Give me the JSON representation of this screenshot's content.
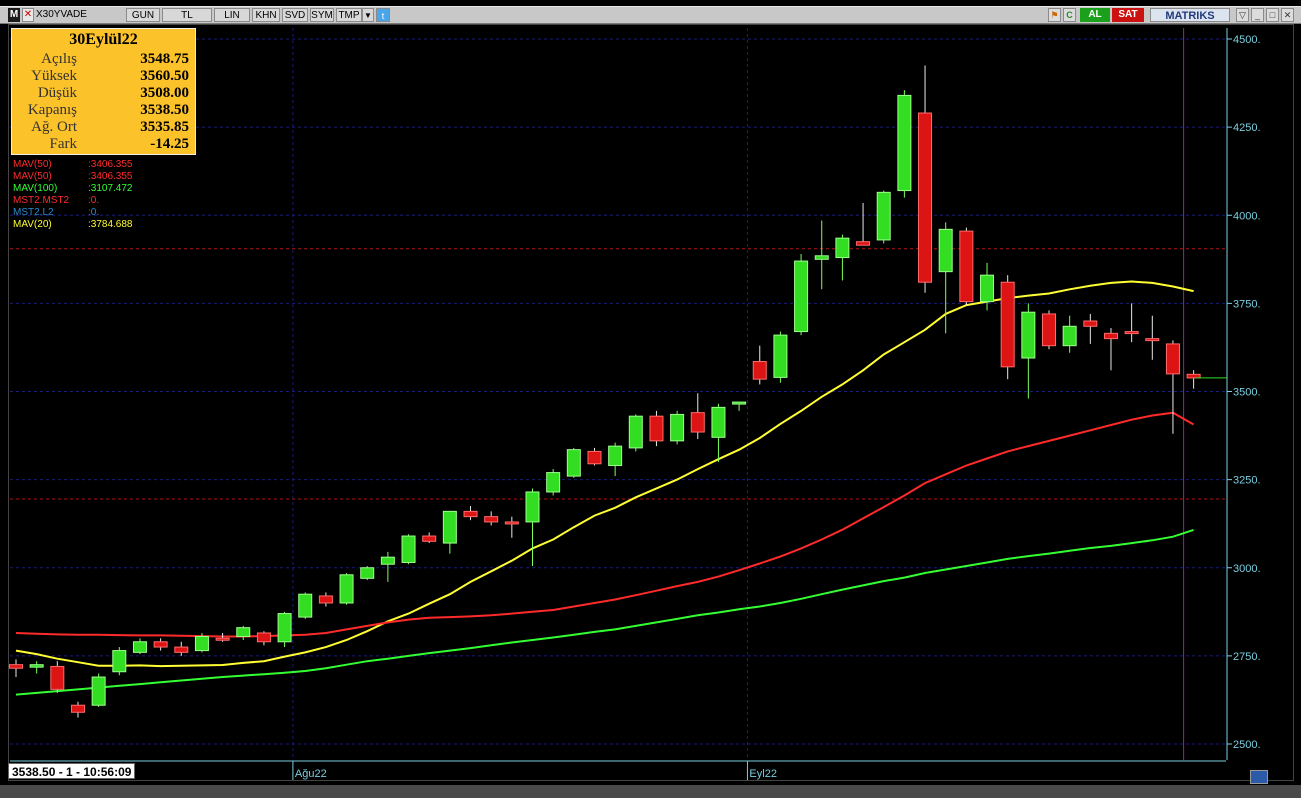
{
  "toolbar": {
    "app_letter": "M",
    "close_icon": "close-x-icon",
    "symbol": "X30YVADE",
    "buttons": [
      "GUN",
      "TL",
      "LIN",
      "KHN",
      "SVD",
      "SYM",
      "TMP"
    ],
    "twitter_icon": "twitter-icon",
    "right_al": "AL",
    "right_sat": "SAT",
    "brand": "MATRIKS"
  },
  "info_box": {
    "date": "30Eylül22",
    "rows": [
      {
        "label": "Açılış",
        "value": "3548.75"
      },
      {
        "label": "Yüksek",
        "value": "3560.50"
      },
      {
        "label": "Düşük",
        "value": "3508.00"
      },
      {
        "label": "Kapanış",
        "value": "3538.50"
      },
      {
        "label": "Ağ. Ort",
        "value": "3535.85"
      },
      {
        "label": "Fark",
        "value": "-14.25"
      }
    ]
  },
  "legend": [
    {
      "label": "MAV(50)",
      "value": ":3406.355",
      "color": "#ff2a2a"
    },
    {
      "label": "MAV(50)",
      "value": ":3406.355",
      "color": "#ff2a2a"
    },
    {
      "label": "MAV(100)",
      "value": ":3107.472",
      "color": "#33ff33"
    },
    {
      "label": "MST2.MST2",
      "value": ":0.",
      "color": "#ff2a2a"
    },
    {
      "label": "MST2.L2",
      "value": ":0.",
      "color": "#2a8acb"
    },
    {
      "label": "MAV(20)",
      "value": ":3784.688",
      "color": "#ffff33"
    }
  ],
  "status_bar": "3538.50 - 1 - 10:56:09",
  "chart_data": {
    "type": "candlestick",
    "y_ticks": [
      "4500.",
      "4250.",
      "4000.",
      "3750.",
      "3500.",
      "3250.",
      "3000.",
      "2750.",
      "2500."
    ],
    "y_tick_values": [
      4500,
      4250,
      4000,
      3750,
      3500,
      3250,
      3000,
      2750,
      2500
    ],
    "ylim": [
      2480,
      4540
    ],
    "x_labels": [
      {
        "label": "Ağu22",
        "index": 14
      },
      {
        "label": "Eyl22",
        "index": 36
      }
    ],
    "reference_lines": [
      3905,
      3195
    ],
    "candles": [
      {
        "o": 2725,
        "h": 2740,
        "l": 2690,
        "c": 2715
      },
      {
        "o": 2718,
        "h": 2735,
        "l": 2700,
        "c": 2725
      },
      {
        "o": 2720,
        "h": 2735,
        "l": 2645,
        "c": 2655
      },
      {
        "o": 2610,
        "h": 2620,
        "l": 2575,
        "c": 2590
      },
      {
        "o": 2610,
        "h": 2700,
        "l": 2605,
        "c": 2690
      },
      {
        "o": 2705,
        "h": 2775,
        "l": 2695,
        "c": 2765
      },
      {
        "o": 2760,
        "h": 2800,
        "l": 2755,
        "c": 2790
      },
      {
        "o": 2790,
        "h": 2800,
        "l": 2765,
        "c": 2775
      },
      {
        "o": 2775,
        "h": 2790,
        "l": 2750,
        "c": 2760
      },
      {
        "o": 2765,
        "h": 2815,
        "l": 2760,
        "c": 2805
      },
      {
        "o": 2800,
        "h": 2815,
        "l": 2790,
        "c": 2795
      },
      {
        "o": 2805,
        "h": 2835,
        "l": 2795,
        "c": 2830
      },
      {
        "o": 2815,
        "h": 2820,
        "l": 2780,
        "c": 2790
      },
      {
        "o": 2790,
        "h": 2875,
        "l": 2775,
        "c": 2870
      },
      {
        "o": 2860,
        "h": 2930,
        "l": 2855,
        "c": 2925
      },
      {
        "o": 2920,
        "h": 2930,
        "l": 2890,
        "c": 2900
      },
      {
        "o": 2900,
        "h": 2985,
        "l": 2895,
        "c": 2980
      },
      {
        "o": 2970,
        "h": 3005,
        "l": 2965,
        "c": 3000
      },
      {
        "o": 3010,
        "h": 3045,
        "l": 2960,
        "c": 3030
      },
      {
        "o": 3015,
        "h": 3095,
        "l": 3010,
        "c": 3090
      },
      {
        "o": 3090,
        "h": 3100,
        "l": 3070,
        "c": 3075
      },
      {
        "o": 3070,
        "h": 3160,
        "l": 3040,
        "c": 3160
      },
      {
        "o": 3160,
        "h": 3175,
        "l": 3135,
        "c": 3145
      },
      {
        "o": 3145,
        "h": 3160,
        "l": 3120,
        "c": 3130
      },
      {
        "o": 3130,
        "h": 3145,
        "l": 3085,
        "c": 3125
      },
      {
        "o": 3130,
        "h": 3225,
        "l": 3005,
        "c": 3215
      },
      {
        "o": 3215,
        "h": 3280,
        "l": 3205,
        "c": 3270
      },
      {
        "o": 3260,
        "h": 3340,
        "l": 3255,
        "c": 3335
      },
      {
        "o": 3330,
        "h": 3340,
        "l": 3290,
        "c": 3295
      },
      {
        "o": 3290,
        "h": 3355,
        "l": 3260,
        "c": 3345
      },
      {
        "o": 3340,
        "h": 3435,
        "l": 3330,
        "c": 3430
      },
      {
        "o": 3430,
        "h": 3445,
        "l": 3345,
        "c": 3360
      },
      {
        "o": 3360,
        "h": 3445,
        "l": 3350,
        "c": 3435
      },
      {
        "o": 3440,
        "h": 3495,
        "l": 3365,
        "c": 3385
      },
      {
        "o": 3370,
        "h": 3465,
        "l": 3300,
        "c": 3455
      },
      {
        "o": 3465,
        "h": 3470,
        "l": 3445,
        "c": 3470
      },
      {
        "o": 3585,
        "h": 3630,
        "l": 3520,
        "c": 3535
      },
      {
        "o": 3540,
        "h": 3670,
        "l": 3525,
        "c": 3660
      },
      {
        "o": 3670,
        "h": 3890,
        "l": 3660,
        "c": 3870
      },
      {
        "o": 3875,
        "h": 3985,
        "l": 3790,
        "c": 3885
      },
      {
        "o": 3880,
        "h": 3945,
        "l": 3815,
        "c": 3935
      },
      {
        "o": 3925,
        "h": 4035,
        "l": 3920,
        "c": 3915
      },
      {
        "o": 3930,
        "h": 4070,
        "l": 3920,
        "c": 4065
      },
      {
        "o": 4070,
        "h": 4355,
        "l": 4050,
        "c": 4340
      },
      {
        "o": 4290,
        "h": 4425,
        "l": 3780,
        "c": 3810
      },
      {
        "o": 3840,
        "h": 3980,
        "l": 3665,
        "c": 3960
      },
      {
        "o": 3955,
        "h": 3965,
        "l": 3745,
        "c": 3755
      },
      {
        "o": 3755,
        "h": 3865,
        "l": 3730,
        "c": 3830
      },
      {
        "o": 3810,
        "h": 3830,
        "l": 3535,
        "c": 3570
      },
      {
        "o": 3595,
        "h": 3750,
        "l": 3480,
        "c": 3725
      },
      {
        "o": 3720,
        "h": 3730,
        "l": 3620,
        "c": 3630
      },
      {
        "o": 3630,
        "h": 3715,
        "l": 3610,
        "c": 3685
      },
      {
        "o": 3700,
        "h": 3720,
        "l": 3635,
        "c": 3685
      },
      {
        "o": 3665,
        "h": 3680,
        "l": 3560,
        "c": 3650
      },
      {
        "o": 3670,
        "h": 3750,
        "l": 3640,
        "c": 3665
      },
      {
        "o": 3650,
        "h": 3715,
        "l": 3590,
        "c": 3645
      },
      {
        "o": 3635,
        "h": 3645,
        "l": 3380,
        "c": 3550
      },
      {
        "o": 3548.75,
        "h": 3560.5,
        "l": 3508,
        "c": 3538.5
      }
    ],
    "series": [
      {
        "name": "MAV(20)",
        "color": "#ffff33",
        "values": [
          2765,
          2755,
          2742,
          2732,
          2722,
          2722,
          2723,
          2721,
          2722,
          2723,
          2724,
          2730,
          2735,
          2748,
          2760,
          2775,
          2795,
          2820,
          2848,
          2870,
          2898,
          2925,
          2960,
          2990,
          3020,
          3055,
          3080,
          3115,
          3148,
          3170,
          3200,
          3225,
          3250,
          3280,
          3308,
          3335,
          3368,
          3408,
          3445,
          3485,
          3520,
          3560,
          3605,
          3640,
          3675,
          3720,
          3745,
          3755,
          3765,
          3772,
          3778,
          3790,
          3800,
          3808,
          3812,
          3808,
          3798,
          3784.688
        ]
      },
      {
        "name": "MAV(50)",
        "color": "#ff2a2a",
        "values": [
          2815,
          2813,
          2811,
          2810,
          2810,
          2809,
          2808,
          2808,
          2807,
          2806,
          2805,
          2805,
          2806,
          2808,
          2810,
          2815,
          2825,
          2835,
          2845,
          2853,
          2858,
          2860,
          2862,
          2865,
          2870,
          2875,
          2880,
          2890,
          2900,
          2910,
          2922,
          2935,
          2948,
          2960,
          2975,
          2993,
          3012,
          3032,
          3055,
          3080,
          3108,
          3140,
          3172,
          3205,
          3240,
          3265,
          3290,
          3310,
          3330,
          3345,
          3360,
          3375,
          3390,
          3405,
          3420,
          3432,
          3440,
          3406.355
        ]
      },
      {
        "name": "MAV(100)",
        "color": "#33ff33",
        "values": [
          2640,
          2645,
          2650,
          2655,
          2660,
          2665,
          2670,
          2675,
          2680,
          2685,
          2690,
          2694,
          2698,
          2702,
          2707,
          2715,
          2725,
          2735,
          2742,
          2750,
          2758,
          2765,
          2772,
          2780,
          2788,
          2795,
          2802,
          2810,
          2818,
          2825,
          2835,
          2845,
          2855,
          2865,
          2873,
          2882,
          2890,
          2900,
          2912,
          2925,
          2938,
          2950,
          2962,
          2972,
          2985,
          2995,
          3005,
          3015,
          3025,
          3033,
          3040,
          3048,
          3056,
          3062,
          3070,
          3078,
          3088,
          3107.472
        ]
      }
    ]
  }
}
